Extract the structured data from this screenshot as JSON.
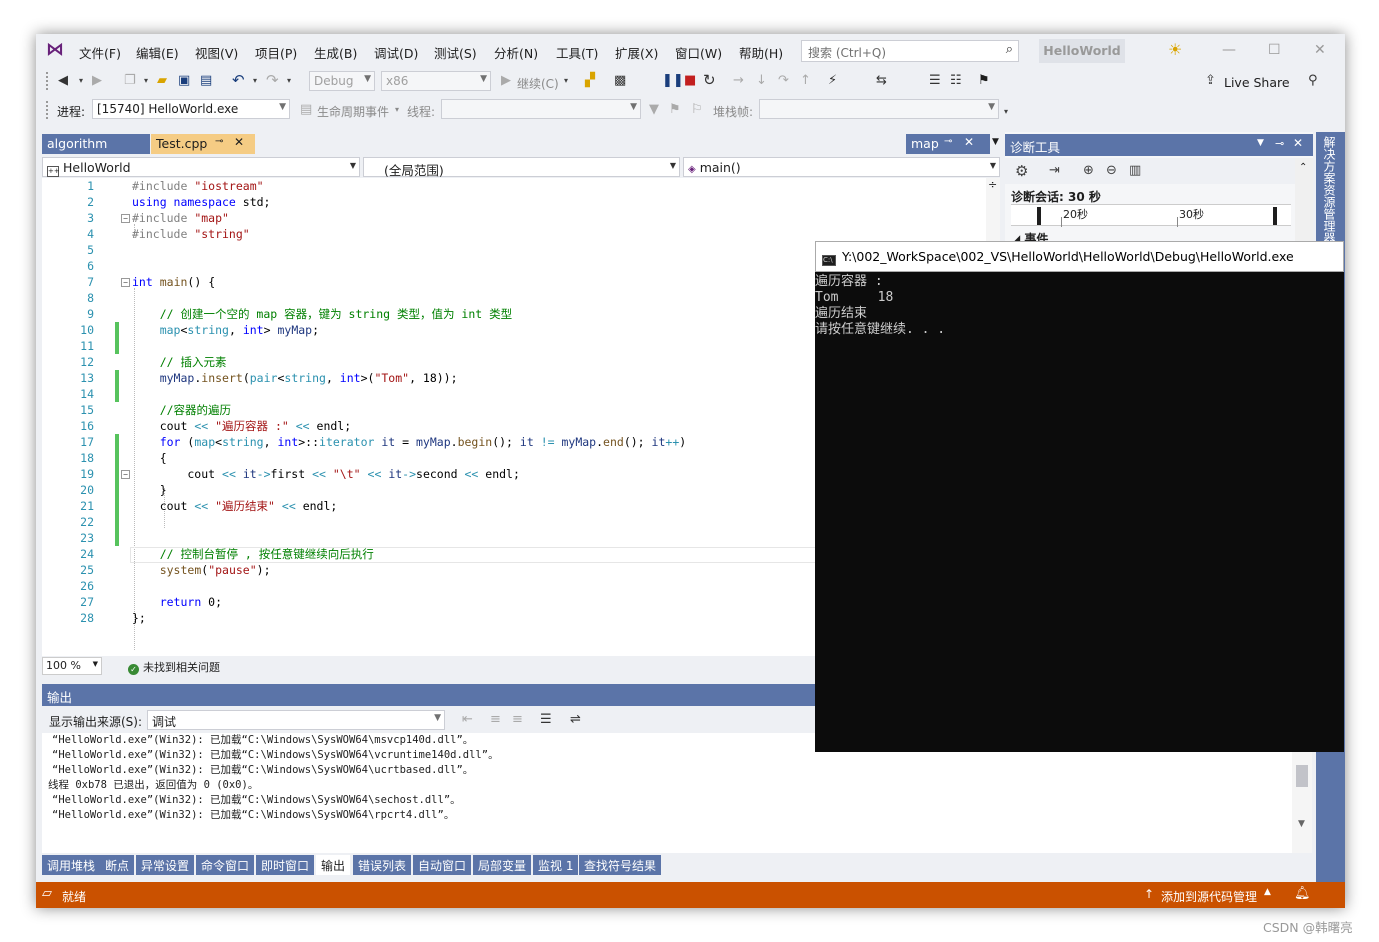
{
  "menu": {
    "items": [
      "文件(F)",
      "编辑(E)",
      "视图(V)",
      "项目(P)",
      "生成(B)",
      "调试(D)",
      "测试(S)",
      "分析(N)",
      "工具(T)",
      "扩展(X)",
      "窗口(W)",
      "帮助(H)"
    ],
    "search_placeholder": "搜索 (Ctrl+Q)",
    "solution_name": "HelloWorld"
  },
  "toolbar": {
    "config": "Debug",
    "platform": "x86",
    "continue_label": "继续(C)",
    "live_share": "Live Share",
    "process_label": "进程:",
    "process_value": "[15740] HelloWorld.exe",
    "lifecycle_label": "生命周期事件",
    "thread_label": "线程:",
    "stackframe_label": "堆栈帧:"
  },
  "tabs": {
    "algorithm": "algorithm",
    "test_cpp": "Test.cpp",
    "map": "map"
  },
  "navbar": {
    "project": "HelloWorld",
    "scope": "(全局范围)",
    "member": "main()"
  },
  "code": {
    "line_numbers": [
      "1",
      "2",
      "3",
      "4",
      "5",
      "6",
      "7",
      "8",
      "9",
      "10",
      "11",
      "12",
      "13",
      "14",
      "15",
      "16",
      "17",
      "18",
      "19",
      "20",
      "21",
      "22",
      "23",
      "24",
      "25",
      "26",
      "27",
      "28"
    ]
  },
  "editor_status": {
    "zoom": "100 %",
    "issues": "未找到相关问题"
  },
  "diagnostics": {
    "title": "诊断工具",
    "session": "诊断会话: 30 秒",
    "tick_20": "20秒",
    "tick_30": "30秒",
    "events": "事件"
  },
  "right_strip": "解决方案资源管理器",
  "output": {
    "title": "输出",
    "source_label": "显示输出来源(S):",
    "source_value": "调试",
    "lines": [
      "“HelloWorld.exe”(Win32): 已加载“C:\\Windows\\SysWOW64\\msvcp140d.dll”。",
      "“HelloWorld.exe”(Win32): 已加载“C:\\Windows\\SysWOW64\\vcruntime140d.dll”。",
      "“HelloWorld.exe”(Win32): 已加载“C:\\Windows\\SysWOW64\\ucrtbased.dll”。",
      "线程 0xb78 已退出，返回值为 0 (0x0)。",
      "“HelloWorld.exe”(Win32): 已加载“C:\\Windows\\SysWOW64\\sechost.dll”。",
      "“HelloWorld.exe”(Win32): 已加载“C:\\Windows\\SysWOW64\\rpcrt4.dll”。"
    ]
  },
  "bottom_tabs": [
    "调用堆栈",
    "断点",
    "异常设置",
    "命令窗口",
    "即时窗口",
    "输出",
    "错误列表",
    "自动窗口",
    "局部变量",
    "监视 1",
    "查找符号结果"
  ],
  "status": {
    "ready": "就绪",
    "source_control": "添加到源代码管理"
  },
  "console": {
    "title": "Y:\\002_WorkSpace\\002_VS\\HelloWorld\\HelloWorld\\Debug\\HelloWorld.exe",
    "lines": [
      "遍历容器 :",
      "Tom     18",
      "遍历结束",
      "请按任意键继续. . ."
    ]
  },
  "watermark": "CSDN @韩曙亮",
  "colors": {
    "accent": "#5b74a8",
    "status": "#ca5100",
    "active_tab": "#f5cc84",
    "console_bg": "#0c0c0c"
  }
}
